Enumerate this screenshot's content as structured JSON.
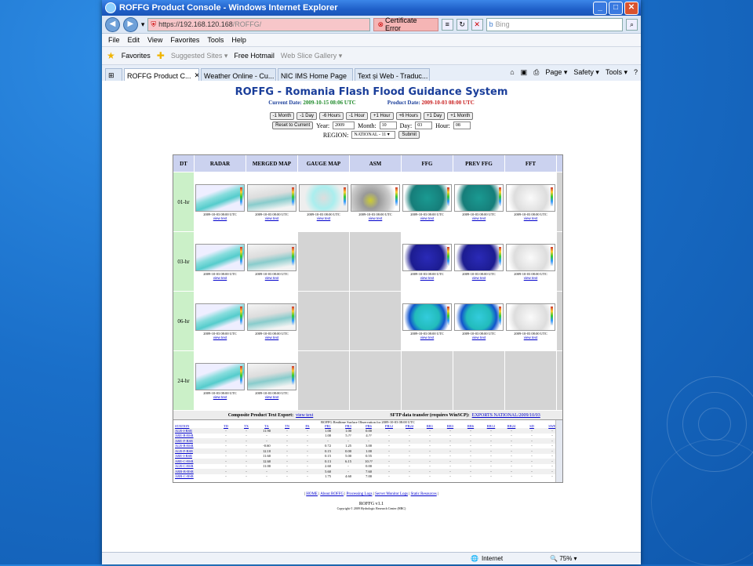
{
  "window": {
    "title": "ROFFG Product Console - Windows Internet Explorer"
  },
  "address": {
    "url_host": "https://192.168.120.168",
    "url_path": "/ROFFG/",
    "cert_error": "Certificate Error",
    "search_placeholder": "Bing"
  },
  "menu": [
    "File",
    "Edit",
    "View",
    "Favorites",
    "Tools",
    "Help"
  ],
  "favorites": {
    "label": "Favorites",
    "items": [
      "Suggested Sites ▾",
      "Free Hotmail",
      "Web Slice Gallery ▾"
    ]
  },
  "tabs": [
    "ROFFG Product C...",
    "Weather Online - Cu...",
    "NIC IMS Home Page",
    "Text și Web - Traduc..."
  ],
  "tabtools": [
    "Page ▾",
    "Safety ▾",
    "Tools ▾"
  ],
  "page": {
    "title": "ROFFG - Romania Flash Flood Guidance System",
    "current_label": "Current Date:",
    "current_value": "2009-10-15 08:06 UTC",
    "product_label": "Product Date:",
    "product_value": "2009-10-03 08:00 UTC",
    "nav_buttons": [
      "-1 Month",
      "-1 Day",
      "-6 Hours",
      "-1 Hour",
      "+1 Hour",
      "+6 Hours",
      "+1 Day",
      "+1 Month"
    ],
    "reset": "Reset to Current",
    "year_label": "Year:",
    "year": "2009",
    "month_label": "Month:",
    "month": "10",
    "day_label": "Day:",
    "day": "03",
    "hour_label": "Hour:",
    "hour": "08",
    "region_label": "REGION:",
    "region": "NATIONAL - 11 ▾",
    "submit": "Submit"
  },
  "grid": {
    "columns": [
      "DT",
      "RADAR",
      "MERGED MAP",
      "GAUGE MAP",
      "ASM",
      "FFG",
      "PREV FFG",
      "FFT"
    ],
    "rows": [
      {
        "dt": "01-hr",
        "cells": [
          1,
          1,
          1,
          1,
          1,
          1,
          1
        ]
      },
      {
        "dt": "03-hr",
        "cells": [
          1,
          1,
          0,
          0,
          1,
          1,
          1
        ]
      },
      {
        "dt": "06-hr",
        "cells": [
          1,
          1,
          0,
          0,
          1,
          1,
          1
        ]
      },
      {
        "dt": "24-hr",
        "cells": [
          1,
          1,
          0,
          0,
          0,
          0,
          0
        ]
      }
    ],
    "caption": "2009-10-03 08:00 UTC",
    "view_link": "view text"
  },
  "export": {
    "left_label": "Composite Product Text Export:",
    "left_link": "view text",
    "right_label": "SFTP data transfer (requires WinSCP):",
    "right_link": "EXPORTS NATIONAL/2009/10/03"
  },
  "obs": {
    "title": "ROFFG Realtime Surface Observation for 2009-10-03 08:00 UTC",
    "headers": [
      "STATION",
      "TD",
      "TX",
      "TA",
      "TN",
      "PA",
      "PR1",
      "PR3",
      "PR6",
      "PR12",
      "PR24",
      "RR1",
      "RR3",
      "RR6",
      "RR12",
      "RR24",
      "SD",
      "SWE"
    ],
    "rows": [
      [
        "ALB-I-BSR",
        "-",
        "-",
        "11.90",
        "-",
        "-",
        "1.00",
        "1.00",
        "0.00",
        "-",
        "-",
        "-",
        "-",
        "-",
        "-",
        "-",
        "-",
        "-"
      ],
      [
        "ARE-B-BSR",
        "-",
        "-",
        "-",
        "-",
        "-",
        "1.00",
        "5.??",
        "4.??",
        "-",
        "-",
        "-",
        "-",
        "-",
        "-",
        "-",
        "-",
        "-"
      ],
      [
        "ARE-F-BSR",
        "-",
        "-",
        "-",
        "-",
        "-",
        "-",
        "-",
        "-",
        "-",
        "-",
        "-",
        "-",
        "-",
        "-",
        "-",
        "-",
        "-"
      ],
      [
        "ALB-B-BSR",
        "-",
        "-",
        "-0.60",
        "-",
        "-",
        "0.72",
        "1.25",
        "3.00",
        "-",
        "-",
        "-",
        "-",
        "-",
        "-",
        "-",
        "-",
        "-"
      ],
      [
        "ALB-F-BSR",
        "-",
        "-",
        "12.10",
        "-",
        "-",
        "0.15",
        "0.00",
        "1.00",
        "-",
        "-",
        "-",
        "-",
        "-",
        "-",
        "-",
        "-",
        "-"
      ],
      [
        "ARE-I-BSR",
        "-",
        "-",
        "11.60",
        "-",
        "-",
        "0.15",
        "5.00",
        "0.55",
        "-",
        "-",
        "-",
        "-",
        "-",
        "-",
        "-",
        "-",
        "-"
      ],
      [
        "ARE-C-BSR",
        "-",
        "-",
        "12.60",
        "-",
        "-",
        "0.13",
        "6.15",
        "10.??",
        "-",
        "-",
        "-",
        "-",
        "-",
        "-",
        "-",
        "-",
        "-"
      ],
      [
        "ALB-C-BSR",
        "-",
        "-",
        "11.00",
        "-",
        "-",
        "2.60",
        "-",
        "0.00",
        "-",
        "-",
        "-",
        "-",
        "-",
        "-",
        "-",
        "-",
        "-"
      ],
      [
        "ARB-B-BSR",
        "-",
        "-",
        "-",
        "-",
        "-",
        "5.60",
        "-",
        "7.60",
        "-",
        "-",
        "-",
        "-",
        "-",
        "-",
        "-",
        "-",
        "-"
      ],
      [
        "ARB-C-BSR",
        "-",
        "-",
        "-",
        "-",
        "-",
        "1.75",
        "4.60",
        "7.00",
        "-",
        "-",
        "-",
        "-",
        "-",
        "-",
        "-",
        "-",
        "-"
      ]
    ]
  },
  "footer": {
    "links": [
      "HOME",
      "About ROFFG",
      "Processing Logs",
      "Server Monitor Logs",
      "Static Resources"
    ],
    "version": "ROFFG v1.1",
    "copyright": "Copyright © 2009 Hydrologic Research Center (HRC)"
  },
  "status": {
    "zone": "Internet",
    "zoom": "75%"
  },
  "colors": {
    "title": "#1a3e9a",
    "current": "#1f8a2a",
    "product": "#c81d1d",
    "dt": "#cbf0c8",
    "header": "#cbd2ef"
  }
}
